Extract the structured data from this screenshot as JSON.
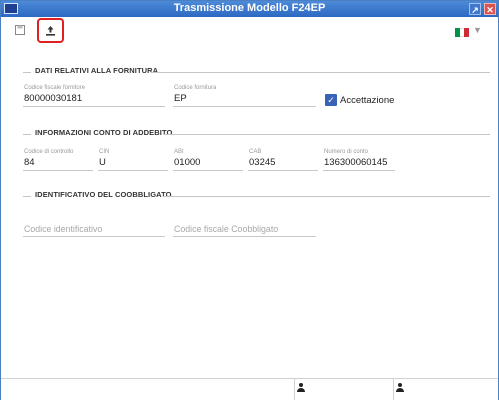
{
  "window": {
    "title": "Trasmissione Modello F24EP",
    "accent_color": "#2c68c2",
    "close_color": "#d9534f"
  },
  "toolbar": {
    "save_icon": "save-icon",
    "upload_icon": "upload-icon",
    "language": "it",
    "flag_colors": [
      "#009246",
      "#ffffff",
      "#ce2b37"
    ]
  },
  "sections": {
    "fornitura": {
      "title": "DATI RELATIVI ALLA FORNITURA",
      "codice_fiscale_fornitore_label": "Codice fiscale fornitore",
      "codice_fiscale_fornitore_value": "80000030181",
      "codice_fornitura_label": "Codice fornitura",
      "codice_fornitura_value": "EP",
      "accettazione_label": "Accettazione",
      "accettazione_checked": true
    },
    "conto": {
      "title": "INFORMAZIONI CONTO DI ADDEBITO",
      "codice_controllo_label": "Codice di controllo",
      "codice_controllo_value": "84",
      "cin_label": "CIN",
      "cin_value": "U",
      "abi_label": "ABI",
      "abi_value": "01000",
      "cab_label": "CAB",
      "cab_value": "03245",
      "numero_conto_label": "Numero di conto",
      "numero_conto_value": "136300060145"
    },
    "coobbligato": {
      "title": "IDENTIFICATIVO DEL COOBBLIGATO",
      "codice_identificativo_placeholder": "Codice identificativo",
      "codice_fiscale_placeholder": "Codice fiscale Coobbligato"
    }
  },
  "statusbar": {
    "user_icon_1": "user-icon",
    "user_icon_2": "user-icon"
  }
}
